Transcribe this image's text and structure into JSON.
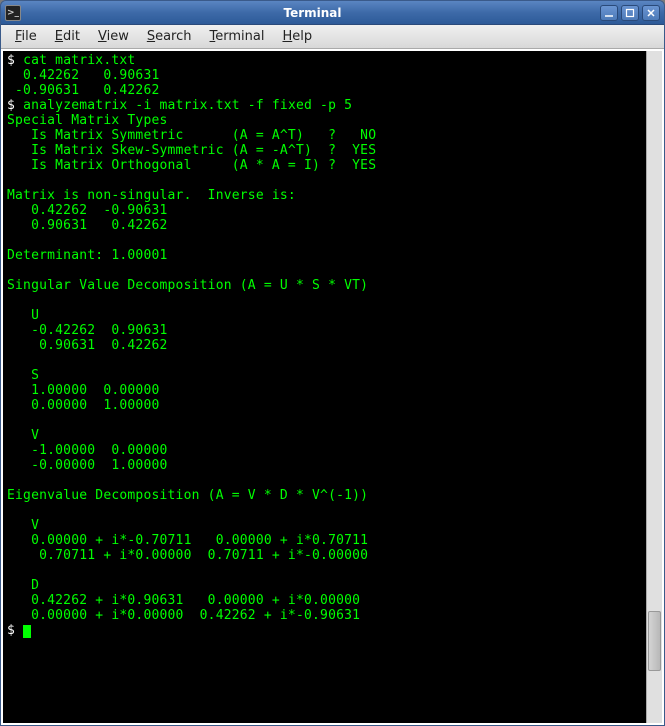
{
  "window": {
    "title": "Terminal"
  },
  "menubar": {
    "items": [
      {
        "underline": "F",
        "rest": "ile"
      },
      {
        "underline": "E",
        "rest": "dit"
      },
      {
        "underline": "V",
        "rest": "iew"
      },
      {
        "underline": "S",
        "rest": "earch"
      },
      {
        "underline": "T",
        "rest": "erminal"
      },
      {
        "underline": "H",
        "rest": "elp"
      }
    ]
  },
  "terminal": {
    "prompt": "$",
    "lines": [
      {
        "prompt": "$ ",
        "text": "cat matrix.txt"
      },
      {
        "prompt": "",
        "text": "  0.42262   0.90631"
      },
      {
        "prompt": "",
        "text": " -0.90631   0.42262"
      },
      {
        "prompt": "$ ",
        "text": "analyzematrix -i matrix.txt -f fixed -p 5"
      },
      {
        "prompt": "",
        "text": "Special Matrix Types"
      },
      {
        "prompt": "",
        "text": "   Is Matrix Symmetric      (A = A^T)   ?   NO"
      },
      {
        "prompt": "",
        "text": "   Is Matrix Skew-Symmetric (A = -A^T)  ?  YES"
      },
      {
        "prompt": "",
        "text": "   Is Matrix Orthogonal     (A * A = I) ?  YES"
      },
      {
        "prompt": "",
        "text": ""
      },
      {
        "prompt": "",
        "text": "Matrix is non-singular.  Inverse is:"
      },
      {
        "prompt": "",
        "text": "   0.42262  -0.90631"
      },
      {
        "prompt": "",
        "text": "   0.90631   0.42262"
      },
      {
        "prompt": "",
        "text": ""
      },
      {
        "prompt": "",
        "text": "Determinant: 1.00001"
      },
      {
        "prompt": "",
        "text": ""
      },
      {
        "prompt": "",
        "text": "Singular Value Decomposition (A = U * S * VT)"
      },
      {
        "prompt": "",
        "text": ""
      },
      {
        "prompt": "",
        "text": "   U"
      },
      {
        "prompt": "",
        "text": "   -0.42262  0.90631"
      },
      {
        "prompt": "",
        "text": "    0.90631  0.42262"
      },
      {
        "prompt": "",
        "text": ""
      },
      {
        "prompt": "",
        "text": "   S"
      },
      {
        "prompt": "",
        "text": "   1.00000  0.00000"
      },
      {
        "prompt": "",
        "text": "   0.00000  1.00000"
      },
      {
        "prompt": "",
        "text": ""
      },
      {
        "prompt": "",
        "text": "   V"
      },
      {
        "prompt": "",
        "text": "   -1.00000  0.00000"
      },
      {
        "prompt": "",
        "text": "   -0.00000  1.00000"
      },
      {
        "prompt": "",
        "text": ""
      },
      {
        "prompt": "",
        "text": "Eigenvalue Decomposition (A = V * D * V^(-1))"
      },
      {
        "prompt": "",
        "text": ""
      },
      {
        "prompt": "",
        "text": "   V"
      },
      {
        "prompt": "",
        "text": "   0.00000 + i*-0.70711   0.00000 + i*0.70711"
      },
      {
        "prompt": "",
        "text": "    0.70711 + i*0.00000  0.70711 + i*-0.00000"
      },
      {
        "prompt": "",
        "text": ""
      },
      {
        "prompt": "",
        "text": "   D"
      },
      {
        "prompt": "",
        "text": "   0.42262 + i*0.90631   0.00000 + i*0.00000"
      },
      {
        "prompt": "",
        "text": "   0.00000 + i*0.00000  0.42262 + i*-0.90631"
      }
    ]
  }
}
